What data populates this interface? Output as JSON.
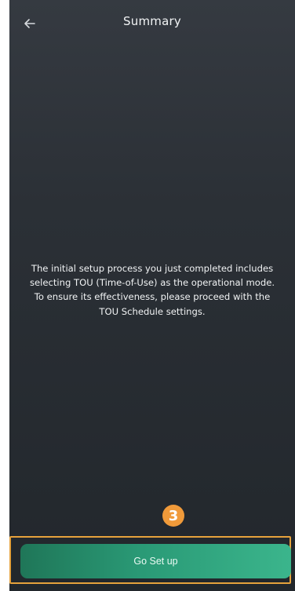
{
  "header": {
    "title": "Summary",
    "back_icon": "arrow-left-icon"
  },
  "main": {
    "message": "The initial setup process you just completed includes selecting TOU (Time-of-Use) as the operational mode. To ensure its effectiveness, please proceed with the TOU Schedule settings."
  },
  "annotation": {
    "step_number": "3"
  },
  "footer": {
    "button_label": "Go Set up"
  },
  "colors": {
    "background": "#2b3036",
    "accent": "#2a9a76",
    "annotation": "#f09a3a"
  }
}
